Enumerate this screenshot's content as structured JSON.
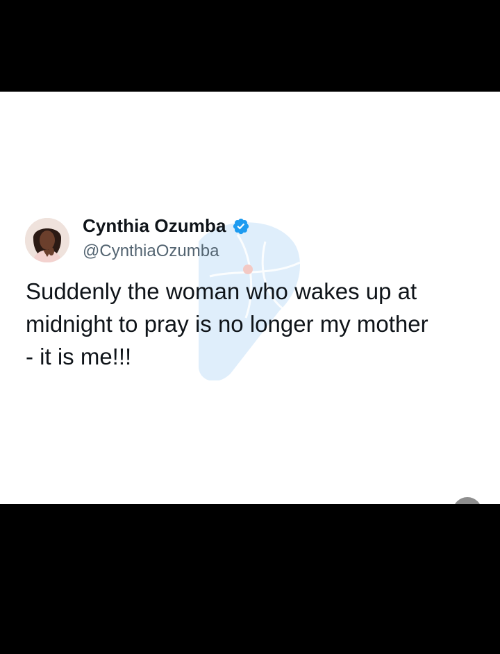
{
  "tweet": {
    "author": {
      "display_name": "Cynthia Ozumba",
      "handle": "@CynthiaOzumba",
      "verified": true,
      "avatar_icon": "profile-photo"
    },
    "text": "Suddenly the woman who wakes up at\nmidnight to pray is no longer my mother\n- it is me!!!"
  },
  "colors": {
    "background_frame": "#000000",
    "card": "#ffffff",
    "name": "#0f1419",
    "handle": "#536471",
    "verified_badge": "#1d9bf0",
    "watermark": "#d8eaf9"
  },
  "icons": {
    "verified": "verified-badge-icon",
    "watermark": "watermark-logo-icon"
  }
}
